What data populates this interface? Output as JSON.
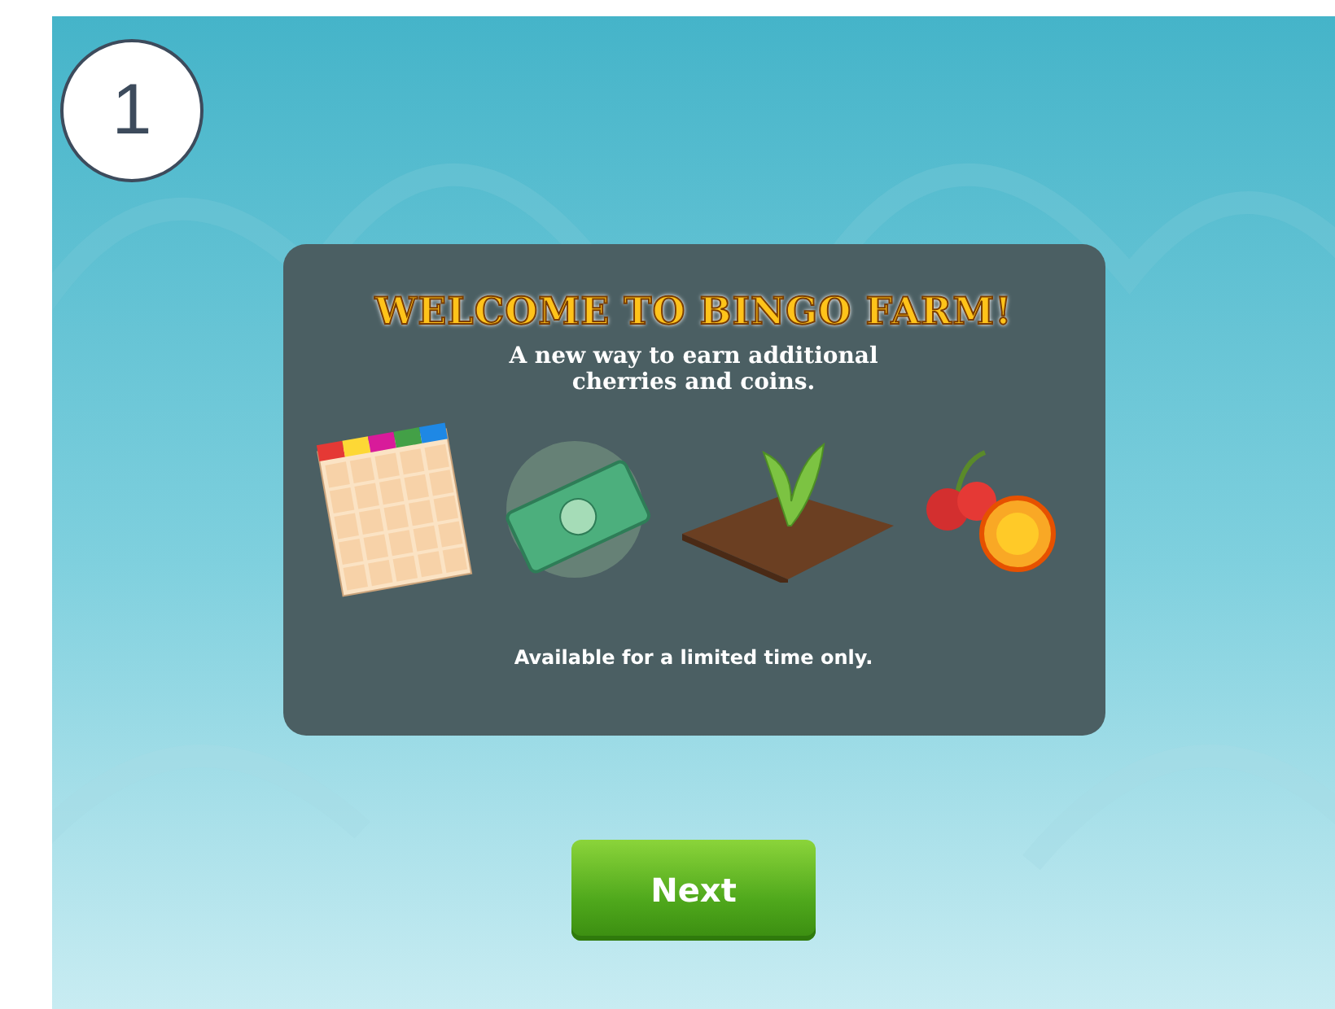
{
  "step_badge": "1",
  "dialog": {
    "title": "WELCOME TO BINGO FARM!",
    "subtitle": "A new way to earn additional cherries and coins.",
    "note": "Available for a limited time only."
  },
  "next_button": "Next"
}
